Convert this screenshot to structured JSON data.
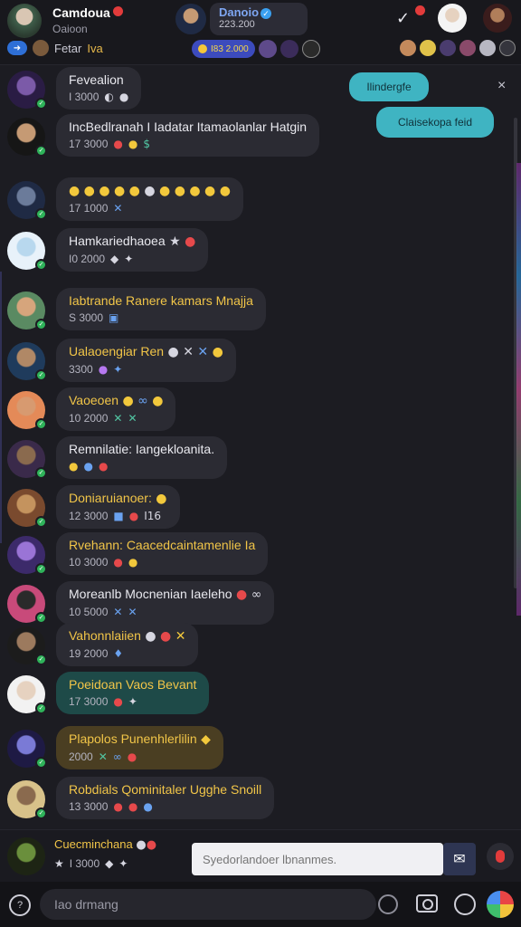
{
  "header": {
    "me_name": "Camdoua",
    "me_sub": "Oaioon",
    "sub_label": "Fetar",
    "sub_label_accent": "Iva",
    "streamer_name": "Danoio",
    "streamer_count": "223.200",
    "viewer_pill_text": "I83 2.000"
  },
  "hints": {
    "first": "Ilindergfe",
    "second": "Claisekopa feid",
    "close": "×"
  },
  "messages": [
    {
      "name": "Fevealion",
      "meta": "I 3000",
      "icons": [
        {
          "g": "◐",
          "c": "w"
        },
        {
          "g": "●",
          "c": "w"
        }
      ],
      "gold": false,
      "emoji": []
    },
    {
      "name": "IncBedlranah I Iadatar Itamaolanlar Hatgin",
      "meta": "17 3000",
      "icons": [
        {
          "g": "●",
          "c": "r"
        },
        {
          "g": "●",
          "c": "y"
        },
        {
          "g": "$",
          "c": "g"
        }
      ],
      "gold": false,
      "emoji": []
    },
    {
      "name": "",
      "meta": "17 1000",
      "icons": [
        {
          "g": "✕",
          "c": "b"
        }
      ],
      "gold": false,
      "emoji": [
        {
          "g": "●",
          "c": "y"
        },
        {
          "g": "●",
          "c": "y"
        },
        {
          "g": "●",
          "c": "y"
        },
        {
          "g": "●",
          "c": "y"
        },
        {
          "g": "●",
          "c": "y"
        },
        {
          "g": "●",
          "c": "w"
        },
        {
          "g": "●",
          "c": "y"
        },
        {
          "g": "●",
          "c": "y"
        },
        {
          "g": "●",
          "c": "y"
        },
        {
          "g": "●",
          "c": "y"
        },
        {
          "g": "●",
          "c": "y"
        }
      ]
    },
    {
      "name": "Hamkariedhaoea",
      "meta": "I0 2000",
      "icons": [
        {
          "g": "◆",
          "c": "w"
        },
        {
          "g": "✦",
          "c": "w"
        }
      ],
      "gold": false,
      "emoji": [
        {
          "g": "★",
          "c": "w"
        },
        {
          "g": "●",
          "c": "r"
        }
      ]
    },
    {
      "name": "Iabtrande Ranere kamars Mnajja",
      "meta": "S 3000",
      "icons": [
        {
          "g": "▣",
          "c": "b"
        }
      ],
      "gold": true,
      "emoji": []
    },
    {
      "name": "Ualaoengiar Ren",
      "meta": "3300",
      "icons": [
        {
          "g": "●",
          "c": "p"
        },
        {
          "g": "✦",
          "c": "b"
        }
      ],
      "gold": true,
      "emoji": [
        {
          "g": "●",
          "c": "w"
        },
        {
          "g": "✕",
          "c": "w"
        },
        {
          "g": "✕",
          "c": "b"
        },
        {
          "g": "●",
          "c": "y"
        }
      ]
    },
    {
      "name": "Vaoeoen",
      "meta": "10 2000",
      "icons": [
        {
          "g": "✕",
          "c": "g"
        },
        {
          "g": "✕",
          "c": "g"
        }
      ],
      "gold": true,
      "emoji": [
        {
          "g": "●",
          "c": "y"
        },
        {
          "g": "∞",
          "c": "b"
        },
        {
          "g": "●",
          "c": "y"
        }
      ]
    },
    {
      "name": "Remnilatie: Iangekloanita.",
      "meta": "",
      "icons": [
        {
          "g": "●",
          "c": "y"
        },
        {
          "g": "●",
          "c": "b"
        },
        {
          "g": "●",
          "c": "r"
        }
      ],
      "gold": false,
      "emoji": []
    },
    {
      "name": "Doniaruianoer:",
      "meta": "12 3000",
      "icons": [
        {
          "g": "■",
          "c": "b"
        },
        {
          "g": "●",
          "c": "r"
        },
        {
          "g": "I16",
          "c": "w"
        }
      ],
      "gold": true,
      "emoji": [
        {
          "g": "●",
          "c": "y"
        }
      ]
    },
    {
      "name": "Rvehann: Caacedcaintamenlie Ia",
      "meta": "10 3000",
      "icons": [
        {
          "g": "●",
          "c": "r"
        },
        {
          "g": "●",
          "c": "y"
        }
      ],
      "gold": true,
      "emoji": []
    },
    {
      "name": "Moreanlb Mocnenian Iaeleho",
      "meta": "10 5000",
      "icons": [
        {
          "g": "✕",
          "c": "b"
        },
        {
          "g": "✕",
          "c": "b"
        }
      ],
      "gold": false,
      "emoji": [
        {
          "g": "●",
          "c": "r"
        },
        {
          "g": "∞",
          "c": "w"
        }
      ]
    },
    {
      "name": "Vahonnlaiien",
      "meta": "19 2000",
      "icons": [
        {
          "g": "♦",
          "c": "b"
        }
      ],
      "gold": true,
      "emoji": [
        {
          "g": "●",
          "c": "w"
        },
        {
          "g": "●",
          "c": "r"
        },
        {
          "g": "✕",
          "c": "y"
        }
      ]
    },
    {
      "name": "Poeidoan Vaos",
      "name_accent": "Bevant",
      "meta": "17 3000",
      "icons": [
        {
          "g": "●",
          "c": "r"
        },
        {
          "g": "✦",
          "c": "w"
        }
      ],
      "gold": true,
      "emoji": []
    },
    {
      "name": "Plapolos Punenhlerlilin",
      "meta": "2000",
      "icons": [
        {
          "g": "✕",
          "c": "g"
        },
        {
          "g": "∞",
          "c": "b"
        },
        {
          "g": "●",
          "c": "r"
        }
      ],
      "gold": true,
      "emoji": [
        {
          "g": "◆",
          "c": "y"
        }
      ]
    },
    {
      "name": "Robdials Qominitaler Ugghe Snoill",
      "meta": "13 3000",
      "icons": [
        {
          "g": "●",
          "c": "r"
        },
        {
          "g": "●",
          "c": "r"
        },
        {
          "g": "●",
          "c": "b"
        }
      ],
      "gold": true,
      "emoji": []
    }
  ],
  "composer": {
    "name": "Cuecminchana",
    "meta": "I 3000",
    "input_placeholder": "Syedorlandoer lbnanmes.",
    "send_icon": "mail-icon"
  },
  "navbar": {
    "input_placeholder": "Iao drmang"
  }
}
